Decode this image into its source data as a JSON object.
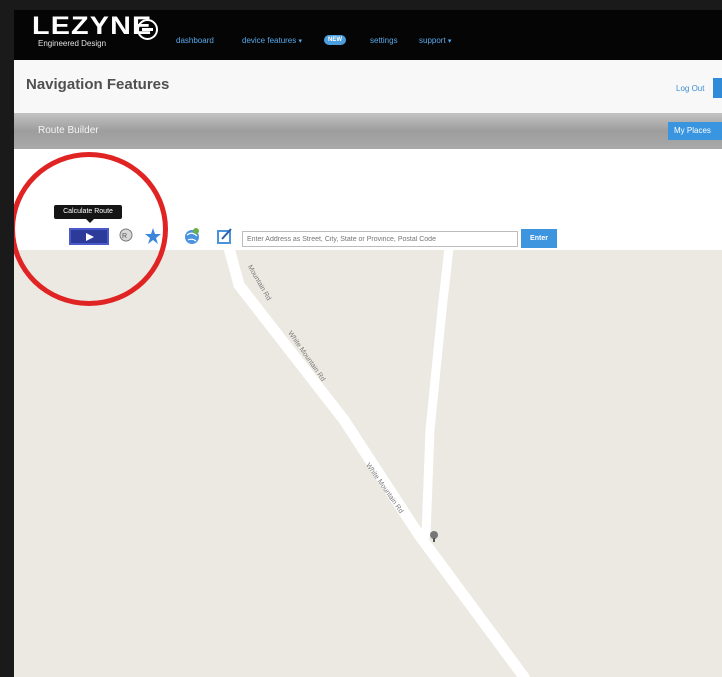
{
  "brand": {
    "logo": "LEZYNE",
    "tagline": "Engineered Design"
  },
  "nav": {
    "items": [
      {
        "label": "dashboard"
      },
      {
        "label": "device features",
        "caret": "▾",
        "badge": "NEW"
      },
      {
        "label": "settings"
      },
      {
        "label": "support",
        "caret": "▾"
      }
    ]
  },
  "header": {
    "title": "Navigation Features",
    "logout": "Log Out"
  },
  "band": {
    "title": "Route Builder",
    "my_places": "My Places"
  },
  "toolbar": {
    "tooltip": "Calculate Route",
    "search_placeholder": "Enter Address as Street, City, State or Province, Postal Code",
    "enter_label": "Enter",
    "icons": [
      "play-icon",
      "pin-icon",
      "star-icon",
      "globe-icon",
      "edit-icon"
    ]
  },
  "map": {
    "road_labels": [
      "Mountain Rd",
      "White Mountain Rd",
      "White Mountain Rd"
    ]
  },
  "colors": {
    "accent": "#3d95e0",
    "highlight_circle": "#e02424",
    "topbar": "#050505",
    "map_bg": "#ece9e2"
  }
}
